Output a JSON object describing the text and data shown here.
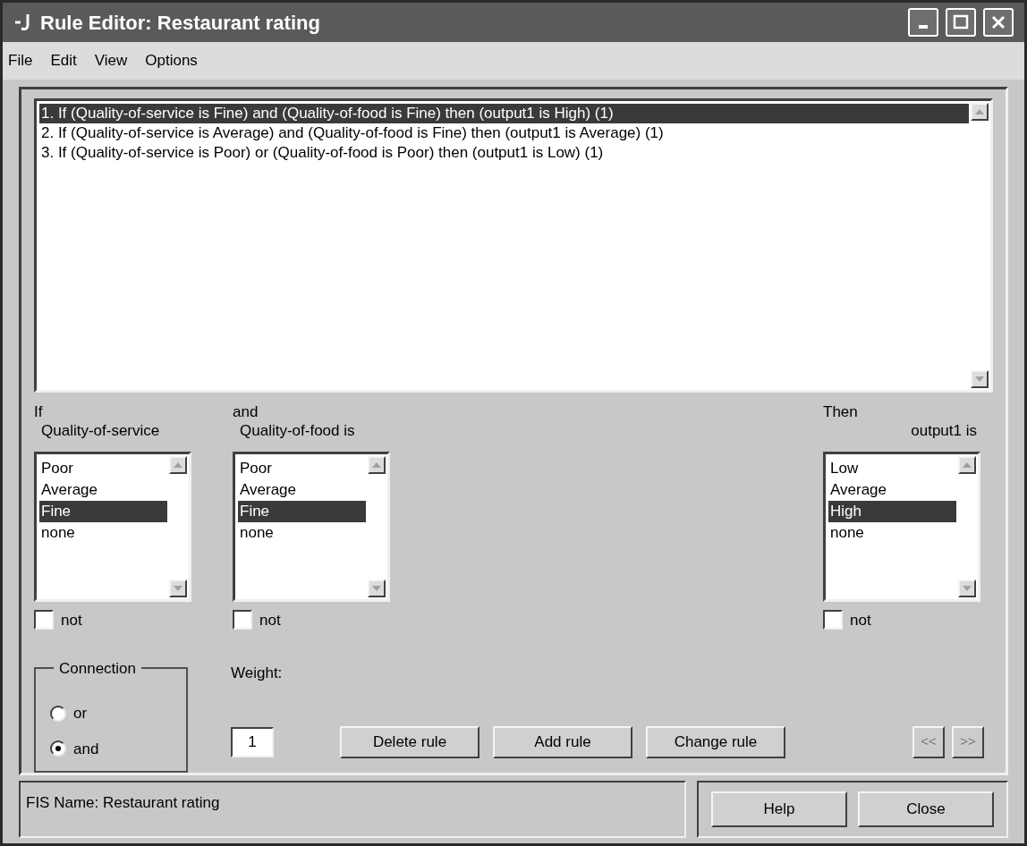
{
  "window": {
    "title": "Rule Editor: Restaurant rating"
  },
  "menu": [
    "File",
    "Edit",
    "View",
    "Options"
  ],
  "rules": [
    {
      "text": "1. If (Quality-of-service is Fine) and (Quality-of-food is Fine) then (output1 is High) (1)",
      "selected": true
    },
    {
      "text": "2. If (Quality-of-service is Average) and (Quality-of-food is Fine) then (output1 is Average) (1)",
      "selected": false
    },
    {
      "text": "3. If (Quality-of-service is Poor) or (Quality-of-food is Poor) then (output1 is Low) (1)",
      "selected": false
    }
  ],
  "columns": [
    {
      "kind": "input",
      "connector": "If",
      "variable": "Quality-of-service",
      "not_label": "not",
      "not_checked": false,
      "options": [
        {
          "label": "Poor",
          "selected": false
        },
        {
          "label": "Average",
          "selected": false
        },
        {
          "label": "Fine",
          "selected": true
        },
        {
          "label": "none",
          "selected": false
        }
      ]
    },
    {
      "kind": "input",
      "connector": "and",
      "variable": "Quality-of-food is",
      "not_label": "not",
      "not_checked": false,
      "options": [
        {
          "label": "Poor",
          "selected": false
        },
        {
          "label": "Average",
          "selected": false
        },
        {
          "label": "Fine",
          "selected": true
        },
        {
          "label": "none",
          "selected": false
        }
      ]
    },
    {
      "kind": "output",
      "connector": "Then",
      "variable": "output1 is",
      "not_label": "not",
      "not_checked": false,
      "options": [
        {
          "label": "Low",
          "selected": false
        },
        {
          "label": "Average",
          "selected": false
        },
        {
          "label": "High",
          "selected": true
        },
        {
          "label": "none",
          "selected": false
        }
      ]
    }
  ],
  "connection": {
    "title": "Connection",
    "options": [
      {
        "label": "or",
        "selected": false
      },
      {
        "label": "and",
        "selected": true
      }
    ]
  },
  "weight": {
    "label": "Weight:",
    "value": "1"
  },
  "buttons": [
    {
      "label": "Delete rule"
    },
    {
      "label": "Add rule"
    },
    {
      "label": "Change rule"
    }
  ],
  "nav_buttons": [
    {
      "label": "<<",
      "disabled": true
    },
    {
      "label": ">>",
      "disabled": true
    }
  ],
  "status": "FIS Name: Restaurant rating",
  "footer_buttons": [
    "Help",
    "Close"
  ]
}
